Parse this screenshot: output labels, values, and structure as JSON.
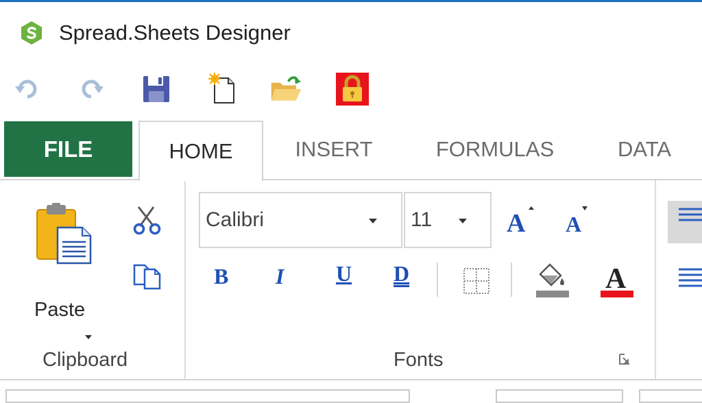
{
  "app": {
    "title": "Spread.Sheets Designer",
    "logo_letter": "S",
    "accent": "#217346",
    "logo_color": "#6cb33f"
  },
  "quick_access": [
    {
      "name": "undo",
      "icon": "undo-icon"
    },
    {
      "name": "redo",
      "icon": "redo-icon"
    },
    {
      "name": "save",
      "icon": "save-icon"
    },
    {
      "name": "new",
      "icon": "new-document-icon"
    },
    {
      "name": "open",
      "icon": "open-folder-icon"
    },
    {
      "name": "lock",
      "icon": "lock-icon"
    }
  ],
  "tabs": {
    "file": "FILE",
    "home": "HOME",
    "insert": "INSERT",
    "formulas": "FORMULAS",
    "data": "DATA"
  },
  "clipboard": {
    "paste_label": "Paste",
    "group_label": "Clipboard"
  },
  "fonts": {
    "font_family": "Calibri",
    "font_size": "11",
    "bold": "B",
    "italic": "I",
    "underline": "U",
    "double_underline": "D",
    "font_color_glyph": "A",
    "grow_glyph": "A",
    "shrink_glyph": "A",
    "group_label": "Fonts",
    "font_color": "#e8141b",
    "fill_color": "#8a8a8a"
  }
}
